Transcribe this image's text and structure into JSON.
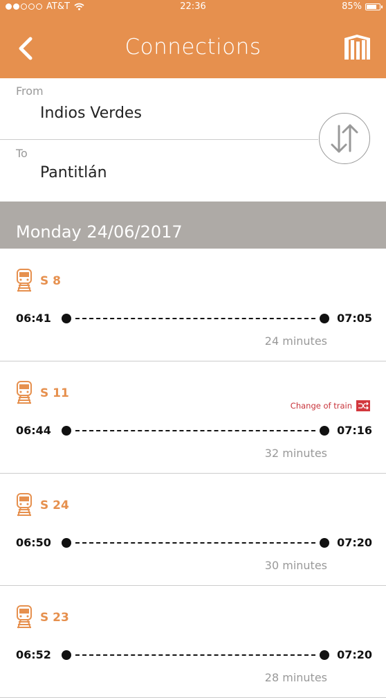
{
  "status_bar": {
    "carrier": "AT&T",
    "time": "22:36",
    "battery": "85%",
    "battery_level": 0.85
  },
  "header": {
    "title": "Connections",
    "back_icon": "chevron-left-icon",
    "logo_icon": "metro-logo-icon"
  },
  "route": {
    "from_label": "From",
    "from_station": "Indios Verdes",
    "to_label": "To",
    "to_station": "Pantitlán",
    "swap_icon": "swap-arrows-icon"
  },
  "date": "Monday 24/06/2017",
  "connections": [
    {
      "line": "S 8",
      "departure": "06:41",
      "arrival": "07:05",
      "duration": "24 minutes",
      "change": ""
    },
    {
      "line": "S 11",
      "departure": "06:44",
      "arrival": "07:16",
      "duration": "32 minutes",
      "change": "Change of train"
    },
    {
      "line": "S 24",
      "departure": "06:50",
      "arrival": "07:20",
      "duration": "30 minutes",
      "change": ""
    },
    {
      "line": "S 23",
      "departure": "06:52",
      "arrival": "07:20",
      "duration": "28 minutes",
      "change": ""
    }
  ],
  "colors": {
    "accent": "#E6904E",
    "date_bar": "#AEAAA6",
    "change": "#D2373D"
  }
}
